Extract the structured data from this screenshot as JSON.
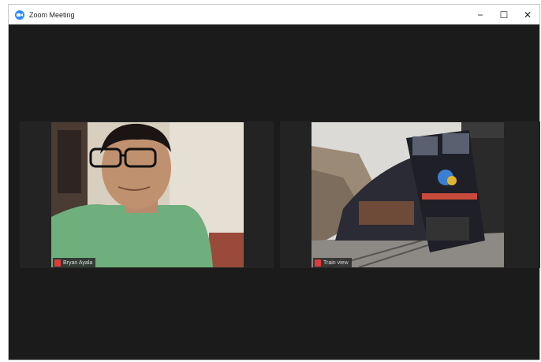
{
  "window": {
    "title": "Zoom Meeting",
    "controls": {
      "minimize": "−",
      "maximize": "☐",
      "close": "✕"
    }
  },
  "participants": [
    {
      "name": "Bryan Ayala",
      "mic_status": "muted",
      "video": "man-with-glasses-green-shirt"
    },
    {
      "name": "Train view",
      "mic_status": "muted",
      "video": "train-on-tracks-mountains"
    }
  ],
  "colors": {
    "zoom_blue": "#2d8cff",
    "muted_red": "#e03b3b",
    "background": "#1b1b1b"
  }
}
